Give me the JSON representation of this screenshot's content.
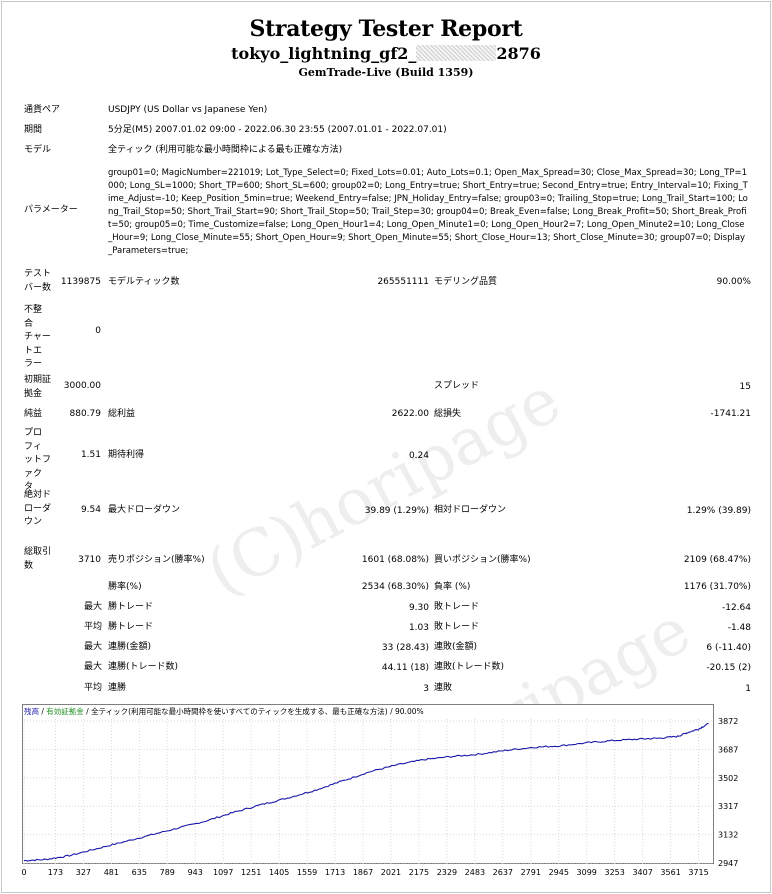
{
  "report": {
    "title": "Strategy Tester Report",
    "ea_name_prefix": "tokyo_lightning_gf2_",
    "ea_name_suffix": "2876",
    "server": "GemTrade-Live (Build 1359)"
  },
  "info": {
    "symbol_label": "通貨ペア",
    "symbol_value": "USDJPY (US Dollar vs Japanese Yen)",
    "period_label": "期間",
    "period_value": "5分足(M5) 2007.01.02 09:00 - 2022.06.30 23:55 (2007.01.01 - 2022.07.01)",
    "model_label": "モデル",
    "model_value": "全ティック (利用可能な最小時間枠による最も正確な方法)",
    "params_label": "パラメーター",
    "params_value": "group01=0; MagicNumber=221019; Lot_Type_Select=0; Fixed_Lots=0.01; Auto_Lots=0.1; Open_Max_Spread=30; Close_Max_Spread=30; Long_TP=1000; Long_SL=1000; Short_TP=600; Short_SL=600; group02=0; Long_Entry=true; Short_Entry=true; Second_Entry=true; Entry_Interval=10; Fixing_Time_Adjust=-10; Keep_Position_5min=true; Weekend_Entry=false; JPN_Holiday_Entry=false; group03=0; Trailing_Stop=true; Long_Trail_Start=100; Long_Trail_Stop=50; Short_Trail_Start=90; Short_Trail_Stop=50; Trail_Step=30; group04=0; Break_Even=false; Long_Break_Profit=50; Short_Break_Profit=50; group05=0; Time_Customize=false; Long_Open_Hour1=4; Long_Open_Minute1=0; Long_Open_Hour2=7; Long_Open_Minute2=10; Long_Close_Hour=9; Long_Close_Minute=55; Short_Open_Hour=9; Short_Open_Minute=55; Short_Close_Hour=13; Short_Close_Minute=30; group07=0; Display_Parameters=true;"
  },
  "stats": {
    "bars_label": [
      "テスト",
      "バー数"
    ],
    "bars_value": "1139875",
    "ticks_label": "モデルティック数",
    "ticks_value": "265551111",
    "quality_label": "モデリング品質",
    "quality_value": "90.00%",
    "mismatch_label": [
      "不整",
      "合",
      "チャー",
      "トエ",
      "ラー"
    ],
    "mismatch_value": "0",
    "deposit_label": [
      "初期証",
      "拠金"
    ],
    "deposit_value": "3000.00",
    "spread_label": "スプレッド",
    "spread_value": "15",
    "net_label": "純益",
    "net_value": "880.79",
    "gross_profit_label": "総利益",
    "gross_profit_value": "2622.00",
    "gross_loss_label": "総損失",
    "gross_loss_value": "-1741.21",
    "pf_label": [
      "プロ",
      "フィ",
      "ットフ",
      "ァク",
      "タ"
    ],
    "pf_value": "1.51",
    "expected_label": "期待利得",
    "expected_value": "0.24",
    "abs_dd_label": [
      "絶対ド",
      "ローダ",
      "ウン"
    ],
    "abs_dd_value": "9.54",
    "max_dd_label": "最大ドローダウン",
    "max_dd_value": "39.89 (1.29%)",
    "rel_dd_label": "相対ドローダウン",
    "rel_dd_value": "1.29% (39.89)",
    "trades_label": [
      "総取引",
      "数"
    ],
    "trades_value": "3710",
    "short_label": "売りポジション(勝率%)",
    "short_value": "1601 (68.08%)",
    "long_label": "買いポジション(勝率%)",
    "long_value": "2109 (68.47%)",
    "win_label": "勝率(%)",
    "win_value": "2534 (68.30%)",
    "loss_label": "負率 (%)",
    "loss_value": "1176 (31.70%)",
    "largest_prefix": "最大",
    "largest_win_label": "勝トレード",
    "largest_win_value": "9.30",
    "largest_loss_label": "敗トレード",
    "largest_loss_value": "-12.64",
    "avg_prefix": "平均",
    "avg_win_label": "勝トレード",
    "avg_win_value": "1.03",
    "avg_loss_label": "敗トレード",
    "avg_loss_value": "-1.48",
    "max_prefix_1": "最大",
    "cons_wins_amt_label": "連勝(金額)",
    "cons_wins_amt_value": "33 (28.43)",
    "cons_loss_amt_label": "連敗(金額)",
    "cons_loss_amt_value": "6 (-11.40)",
    "max_prefix_2": "最大",
    "cons_profit_label": "連勝(トレード数)",
    "cons_profit_value": "44.11 (18)",
    "cons_lossamt_label": "連敗(トレード数)",
    "cons_lossamt_value": "-20.15 (2)",
    "avg_prefix_2": "平均",
    "avg_cons_win_label": "連勝",
    "avg_cons_win_value": "3",
    "avg_cons_loss_label": "連敗",
    "avg_cons_loss_value": "1"
  },
  "chart_header": {
    "balance": "残高",
    "sep1": " / ",
    "equity": "有効証拠金",
    "sep2": " / ",
    "model": "全ティック(利用可能な最小時間枠を使いすべてのティックを生成する、最も正確な方法)",
    "sep3": " / ",
    "quality": "90.00%"
  },
  "watermark": "(C)horipage",
  "chart_data": {
    "type": "line",
    "x_ticks": [
      "0",
      "173",
      "327",
      "481",
      "635",
      "789",
      "943",
      "1097",
      "1251",
      "1405",
      "1559",
      "1713",
      "1867",
      "2021",
      "2175",
      "2329",
      "2483",
      "2637",
      "2791",
      "2945",
      "3099",
      "3253",
      "3407",
      "3561",
      "3715"
    ],
    "y_ticks": [
      "3872",
      "3687",
      "3502",
      "3317",
      "3132",
      "2947"
    ],
    "ylim": [
      2947,
      3872
    ],
    "xlim": [
      0,
      3800
    ],
    "series": [
      {
        "color": "#1a1aa8",
        "x": [
          0,
          120,
          250,
          400,
          550,
          700,
          850,
          1000,
          1150,
          1300,
          1450,
          1600,
          1750,
          1900,
          2050,
          2200,
          2350,
          2500,
          2650,
          2800,
          2950,
          3100,
          3250,
          3400,
          3500,
          3600,
          3650,
          3715,
          3770
        ],
        "values": [
          2963,
          2970,
          2995,
          3040,
          3085,
          3130,
          3175,
          3220,
          3275,
          3325,
          3370,
          3420,
          3480,
          3540,
          3585,
          3620,
          3640,
          3655,
          3680,
          3700,
          3710,
          3730,
          3745,
          3755,
          3760,
          3772,
          3795,
          3820,
          3855
        ]
      }
    ]
  }
}
